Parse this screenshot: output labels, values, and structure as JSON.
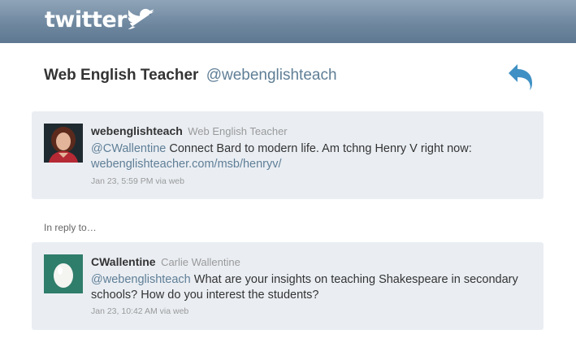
{
  "brand": {
    "logo_text": "twitter",
    "icon": "twitter-bird-icon"
  },
  "header": {
    "name": "Web English Teacher",
    "handle": "@webenglishteach",
    "reply_icon": "reply-icon"
  },
  "tweets": [
    {
      "username": "webenglishteach",
      "fullname": "Web English Teacher",
      "avatar": "teacher-photo",
      "mention": "@CWallentine",
      "text": " Connect Bard to modern life. Am tchng Henry V right now: ",
      "link": "webenglishteacher.com/msb/henryv/",
      "meta": "Jan 23, 5:59 PM via web"
    },
    {
      "username": "CWallentine",
      "fullname": "Carlie Wallentine",
      "avatar": "default-egg",
      "mention": "@webenglishteach",
      "text": " What are your insights on teaching Shakespeare in secondary schools? How do you interest the students?",
      "link": "",
      "meta": "Jan 23, 10:42 AM via web"
    }
  ],
  "in_reply_label": "In reply to…",
  "colors": {
    "topbar": "#7a92a9",
    "card_bg": "#eaeef3",
    "link": "#5f7e96",
    "reply_icon": "#3f90c4"
  }
}
